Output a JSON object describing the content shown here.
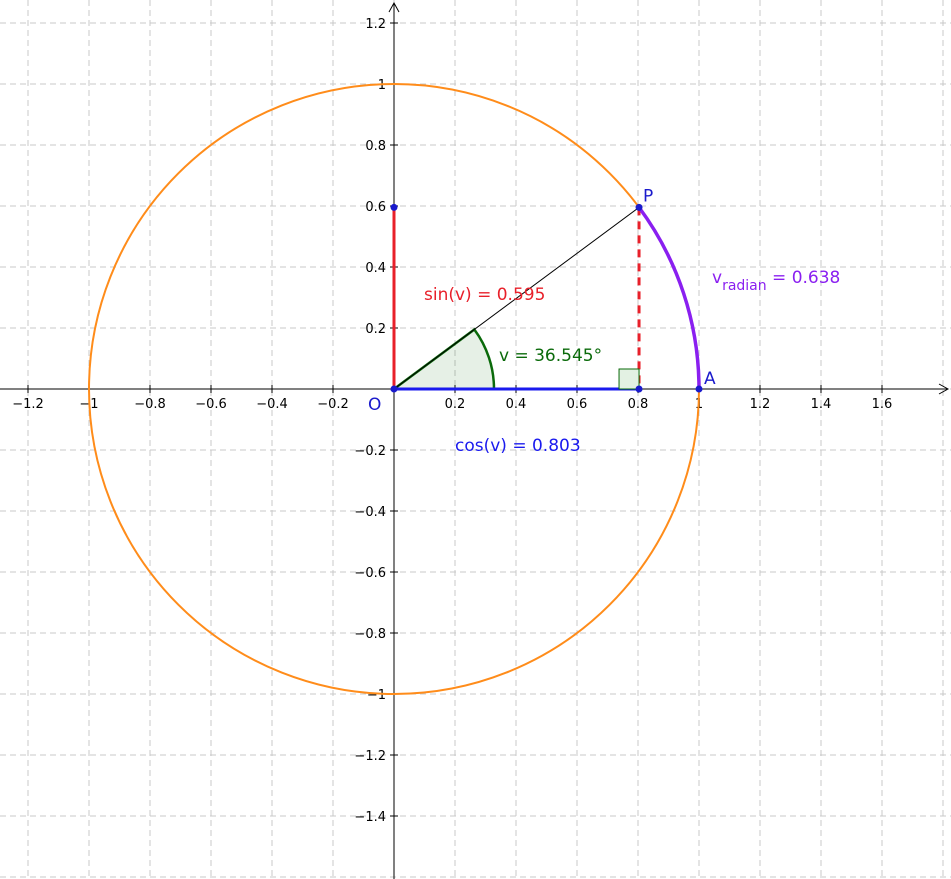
{
  "figure": {
    "x_axis": {
      "range": [
        -1.25,
        1.8
      ],
      "ticks": [
        -1.2,
        -1,
        -0.8,
        -0.6,
        -0.4,
        -0.2,
        0.2,
        0.4,
        0.6,
        0.8,
        1,
        1.2,
        1.4,
        1.6
      ],
      "tick_labels": [
        "−1.2",
        "−1",
        "−0.8",
        "−0.6",
        "−0.4",
        "−0.2",
        "0.2",
        "0.4",
        "0.6",
        "0.8",
        "1",
        "1.2",
        "1.4",
        "1.6"
      ]
    },
    "y_axis": {
      "range": [
        -1.6,
        1.25
      ],
      "ticks": [
        1.2,
        1,
        0.8,
        0.6,
        0.4,
        0.2,
        -0.2,
        -0.4,
        -0.6,
        -0.8,
        -1,
        -1.2,
        -1.4
      ],
      "tick_labels": [
        "1.2",
        "1",
        "0.8",
        "0.6",
        "0.4",
        "0.2",
        "−0.2",
        "−0.4",
        "−0.6",
        "−0.8",
        "−1",
        "−1.2",
        "−1.4"
      ]
    },
    "grid": "dashed",
    "unit_circle": {
      "radius": 1,
      "color": "#ff8c1a"
    },
    "angle_deg": 36.545,
    "points": {
      "origin": "O",
      "A": "A",
      "P": "P"
    },
    "colors": {
      "sin": "#e8202a",
      "cos": "#1a1aee",
      "arc": "#8a1ff0",
      "angle": "#0a6a0a",
      "point": "#1a1acc"
    },
    "labels": {
      "sin": "sin(v) = 0.595",
      "cos": "cos(v) = 0.803",
      "angle": "v = 36.545°",
      "radian_main": "v",
      "radian_sub": "radian",
      "radian_value": " = 0.638"
    }
  }
}
